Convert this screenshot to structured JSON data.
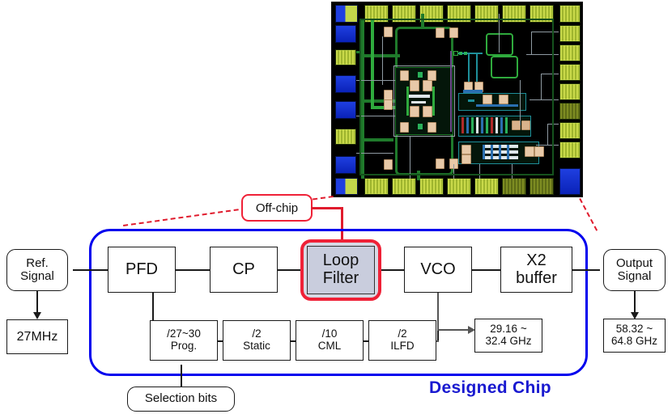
{
  "figure": {
    "title": "PLL block diagram with chip die photograph",
    "colors": {
      "chip_boundary": "#0000ee",
      "off_chip_highlight": "#ef2137",
      "designed_chip_label": "#1919d0",
      "loop_filter_fill": "#c9cddd",
      "die_background": "#000000",
      "pad_yellow": "#c3d64a",
      "pad_blue": "#1f3fe0",
      "metal_green": "#1f7a2b"
    }
  },
  "die_photo": {
    "name": "chip-die-micrograph",
    "description": "Die layout micrograph with bond pads around the periphery"
  },
  "annotations": {
    "off_chip": "Off-chip",
    "designed_chip": "Designed Chip"
  },
  "diagram": {
    "ref_signal": {
      "line1": "Ref.",
      "line2": "Signal"
    },
    "ref_freq": "27MHz",
    "pfd": "PFD",
    "cp": "CP",
    "loop_filter": {
      "line1": "Loop",
      "line2": "Filter"
    },
    "vco": "VCO",
    "x2_buffer": {
      "line1": "X2",
      "line2": "buffer"
    },
    "vco_freq": {
      "line1": "29.16 ~",
      "line2": "32.4 GHz"
    },
    "output_signal": {
      "line1": "Output",
      "line2": "Signal"
    },
    "output_freq": {
      "line1": "58.32 ~",
      "line2": "64.8 GHz"
    },
    "dividers": [
      {
        "line1": "/27~30",
        "line2": "Prog."
      },
      {
        "line1": "/2",
        "line2": "Static"
      },
      {
        "line1": "/10",
        "line2": "CML"
      },
      {
        "line1": "/2",
        "line2": "ILFD"
      }
    ],
    "selection_bits": "Selection bits"
  }
}
